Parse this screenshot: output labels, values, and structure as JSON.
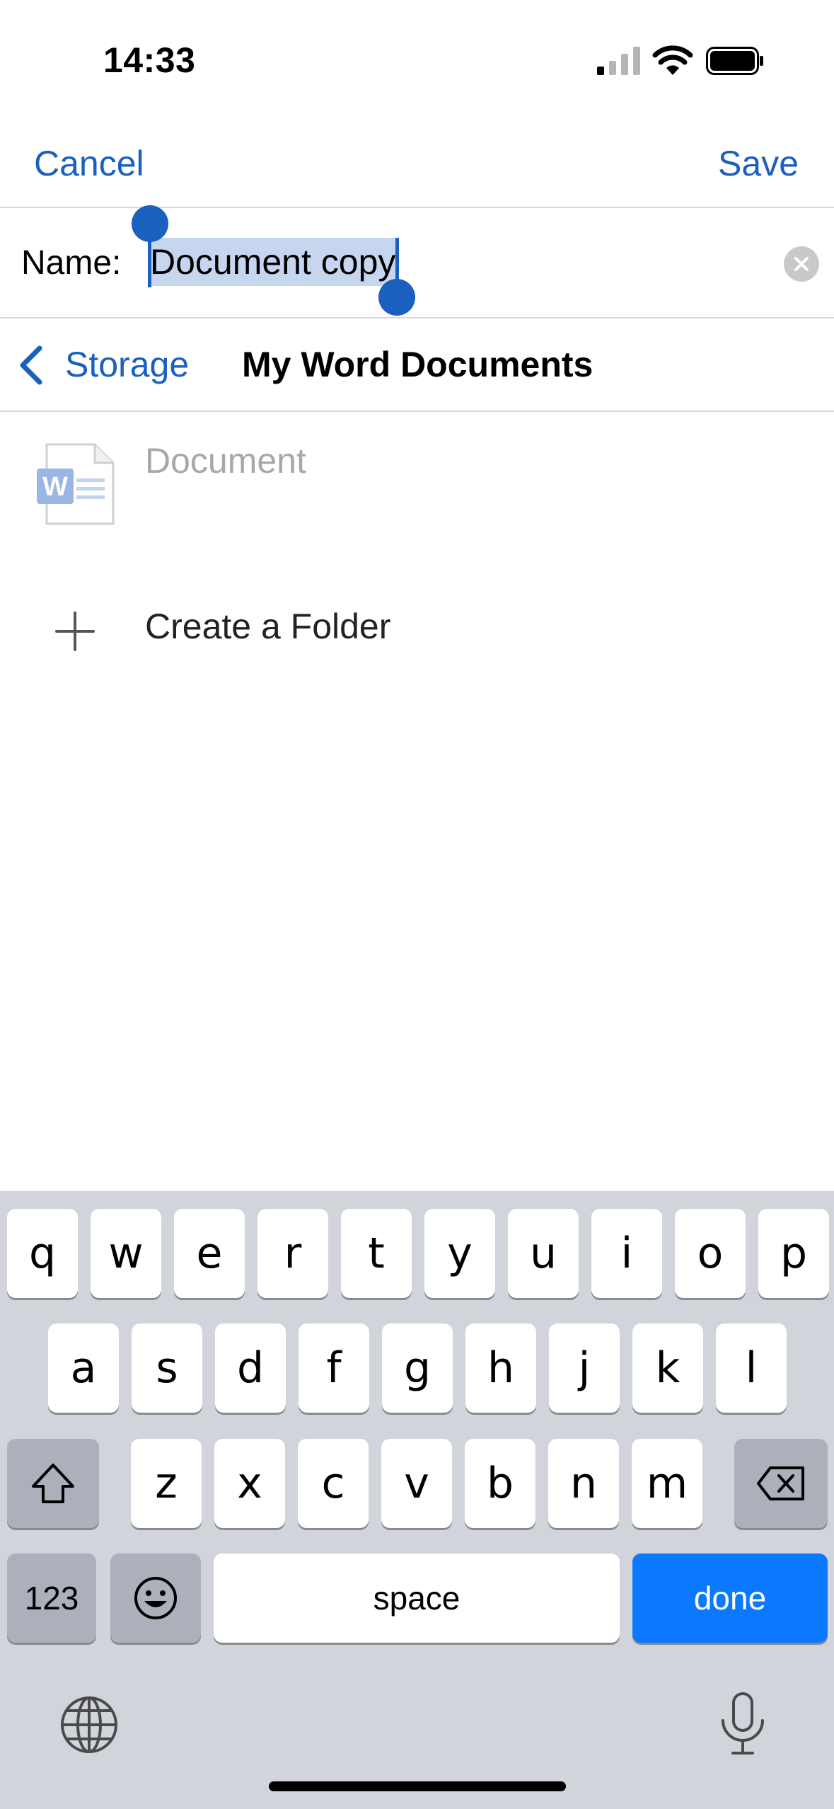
{
  "status_bar": {
    "time": "14:33"
  },
  "nav": {
    "cancel_label": "Cancel",
    "save_label": "Save"
  },
  "name_field": {
    "label": "Name:",
    "value": "Document copy"
  },
  "location": {
    "back_label": "Storage",
    "title": "My Word Documents"
  },
  "list": {
    "document_label": "Document",
    "create_folder_label": "Create a Folder"
  },
  "keyboard": {
    "row1": [
      "q",
      "w",
      "e",
      "r",
      "t",
      "y",
      "u",
      "i",
      "o",
      "p"
    ],
    "row2": [
      "a",
      "s",
      "d",
      "f",
      "g",
      "h",
      "j",
      "k",
      "l"
    ],
    "row3": [
      "z",
      "x",
      "c",
      "v",
      "b",
      "n",
      "m"
    ],
    "numbers_label": "123",
    "space_label": "space",
    "done_label": "done"
  },
  "colors": {
    "accent": "#1b5fbf",
    "done_key": "#0a78ff",
    "keyboard_bg": "#d1d4db"
  }
}
